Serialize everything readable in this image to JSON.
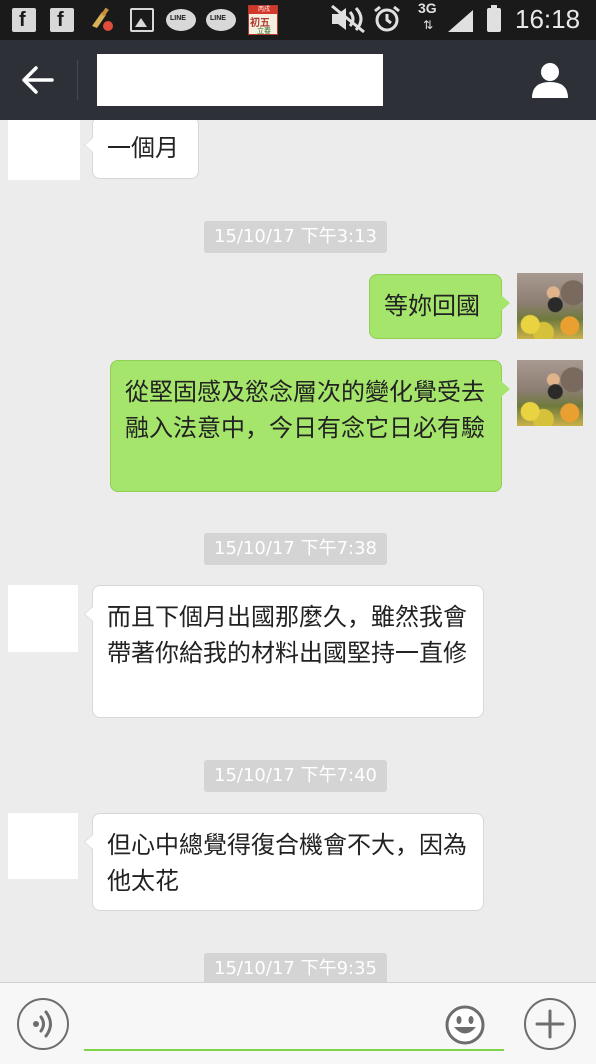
{
  "status_bar": {
    "facebook_letter": "f",
    "line_label": "LINE",
    "calendar_top": "丙戌",
    "calendar_main": "初五",
    "calendar_sub": "立春",
    "network": "3G",
    "network_arrows": "⇅",
    "time": "16:18"
  },
  "header": {
    "contact_name": ""
  },
  "messages": [
    {
      "side": "in",
      "text": "一個月"
    },
    {
      "type": "timestamp",
      "text": "15/10/17 下午3:13"
    },
    {
      "side": "out",
      "text": "等妳回國"
    },
    {
      "side": "out",
      "text": "從堅固感及慾念層次的變化覺受去融入法意中，今日有念它日必有驗"
    },
    {
      "type": "timestamp",
      "text": "15/10/17 下午7:38"
    },
    {
      "side": "in",
      "text": "而且下個月出國那麼久，雖然我會帶著你給我的材料出國堅持一直修"
    },
    {
      "type": "timestamp",
      "text": "15/10/17 下午7:40"
    },
    {
      "side": "in",
      "text": "但心中總覺得復合機會不大，因為他太花"
    },
    {
      "type": "timestamp",
      "text": "15/10/17 下午9:35"
    }
  ],
  "input": {
    "value": "",
    "placeholder": ""
  },
  "icons": {
    "back": "arrow-left-icon",
    "profile": "person-icon",
    "voice": "voice-icon",
    "emoji": "smiley-icon",
    "plus": "plus-icon"
  },
  "colors": {
    "header_bg": "#2d3137",
    "outgoing_bubble": "#a5e56b",
    "incoming_bubble": "#ffffff",
    "chat_bg": "#ececec",
    "accent": "#7fd34a"
  }
}
